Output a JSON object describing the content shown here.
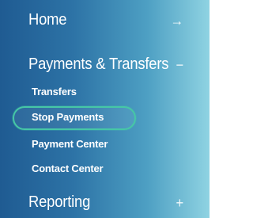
{
  "nav": {
    "home": {
      "label": "Home",
      "icon": "arrow-right-icon"
    },
    "payments": {
      "label": "Payments & Transfers",
      "icon": "minus-icon",
      "children": [
        {
          "label": "Transfers"
        },
        {
          "label": "Stop Payments",
          "highlighted": true
        },
        {
          "label": "Payment Center"
        },
        {
          "label": "Contact Center"
        }
      ]
    },
    "reporting": {
      "label": "Reporting",
      "icon": "plus-icon"
    }
  },
  "colors": {
    "highlight_border": "#46c7a6",
    "gradient_left": "#1f5b92",
    "gradient_right": "#8fd3e2"
  }
}
